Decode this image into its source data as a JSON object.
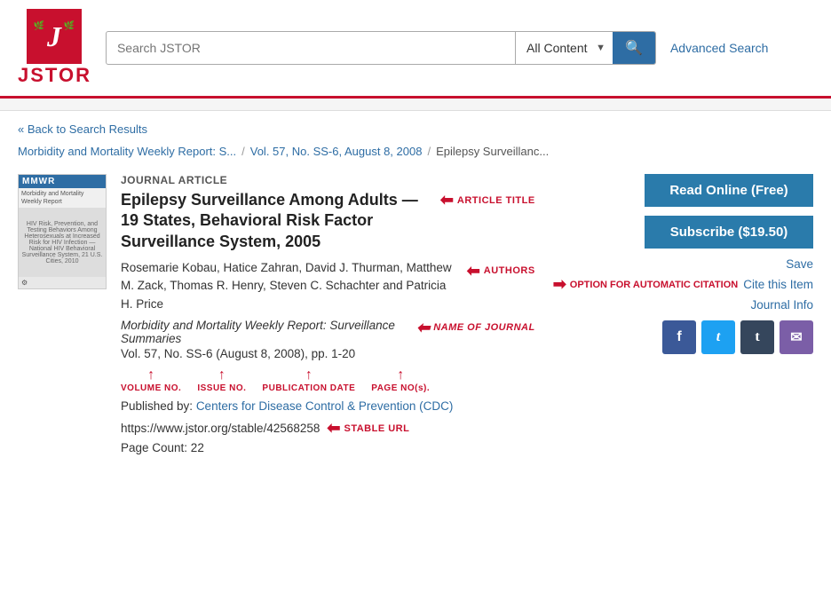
{
  "header": {
    "logo_text": "JSTOR",
    "search_placeholder": "Search JSTOR",
    "content_filter": "All Content",
    "advanced_search_label": "Advanced Search"
  },
  "nav": {
    "back_link": "« Back to Search Results",
    "breadcrumb": [
      {
        "text": "Morbidity and Mortality Weekly Report: S...",
        "link": true
      },
      {
        "text": "Vol. 57, No. SS-6, August 8, 2008",
        "link": true
      },
      {
        "text": "Epilepsy Surveillanc...",
        "link": false
      }
    ],
    "breadcrumb_sep": "/"
  },
  "article": {
    "type": "JOURNAL ARTICLE",
    "title": "Epilepsy Surveillance Among Adults — 19 States, Behavioral Risk Factor Surveillance System, 2005",
    "title_annotation": "ARTICLE TITLE",
    "authors": "Rosemarie Kobau, Hatice Zahran, David J. Thurman, Matthew M. Zack, Thomas R. Henry, Steven C. Schachter and Patricia H. Price",
    "authors_annotation": "AUTHORS",
    "journal_name": "Morbidity and Mortality Weekly Report: Surveillance Summaries",
    "journal_annotation": "NAME OF JOURNAL",
    "volume_issue": "Vol. 57, No. SS-6 (August 8, 2008), pp. 1-20",
    "vol_annotation": "VOLUME NO.",
    "issue_annotation": "ISSUE NO.",
    "date_annotation": "PUBLICATION DATE",
    "pages_annotation": "PAGE NO(s).",
    "publisher_prefix": "Published by: ",
    "publisher_name": "Centers for Disease Control & Prevention (CDC)",
    "stable_url": "https://www.jstor.org/stable/42568258",
    "stable_url_annotation": "STABLE URL",
    "page_count": "Page Count: 22"
  },
  "actions": {
    "read_online": "Read Online (Free)",
    "subscribe": "Subscribe ($19.50)",
    "save": "Save",
    "option_label": "OPTION FOR AUTOMATIC CITATION",
    "cite_label": "Cite this Item",
    "journal_info": "Journal Info"
  },
  "social": {
    "facebook": "f",
    "twitter": "t",
    "tumblr": "t",
    "email": "✉"
  }
}
